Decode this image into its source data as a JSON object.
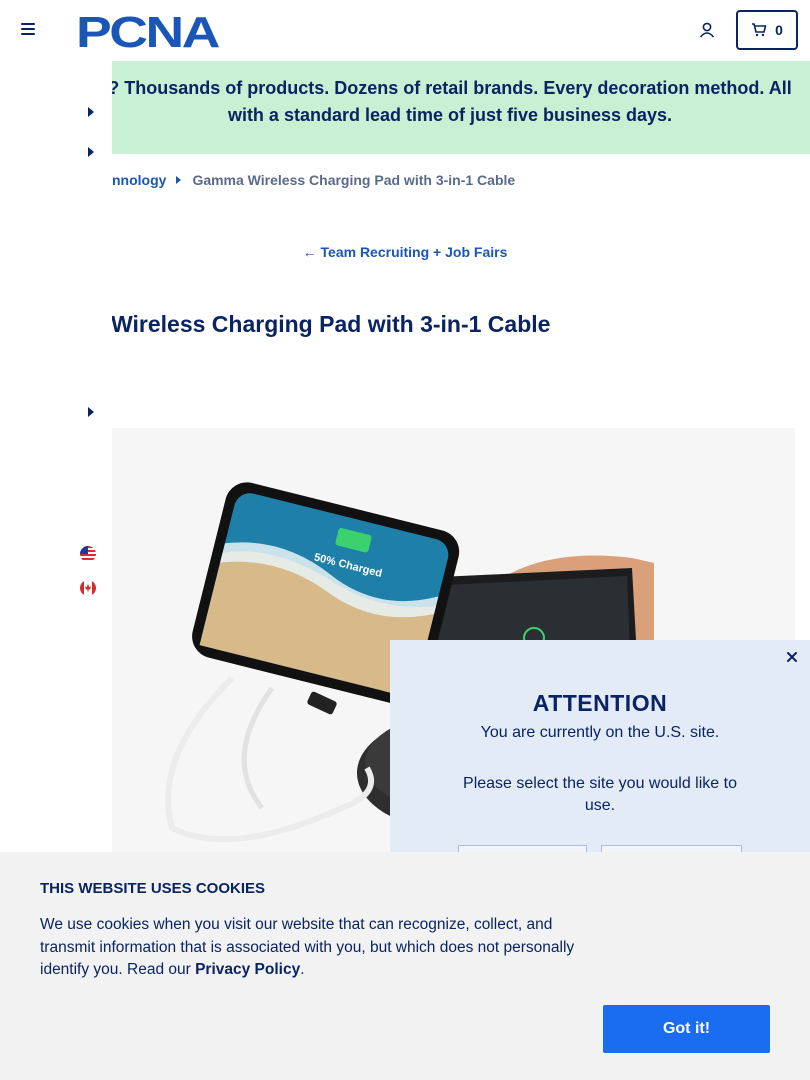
{
  "header": {
    "logo_text": "PCNA",
    "cart_count": "0"
  },
  "promo": {
    "text": "? Thousands of products. Dozens of retail brands. Every decoration method. All with a standard lead time of just five business days."
  },
  "breadcrumb": {
    "parent": "nnology",
    "current": "Gamma Wireless Charging Pad with 3-in-1 Cable"
  },
  "back_link": "← Team Recruiting + Job Fairs",
  "title": "Wireless Charging Pad with 3-in-1 Cable",
  "product_image": {
    "screen_text": "50% Charged"
  },
  "attention": {
    "title": "ATTENTION",
    "line1": "You are currently on the U.S. site.",
    "line2": "Please select the site you would like to use."
  },
  "cookie": {
    "title": "THIS WEBSITE USES COOKIES",
    "text_before": "We use cookies when you visit our website that can recognize, collect, and transmit information that is associated with you, but which does not personally identify you. Read our ",
    "policy_link": "Privacy Policy",
    "text_after": ".",
    "button": "Got it!"
  },
  "colors": {
    "navy": "#0a2463",
    "link_blue": "#1a56b8",
    "promo_green": "#c8f0d2",
    "modal_bg": "#e3ebf7",
    "cookie_button": "#1a6cf0"
  }
}
